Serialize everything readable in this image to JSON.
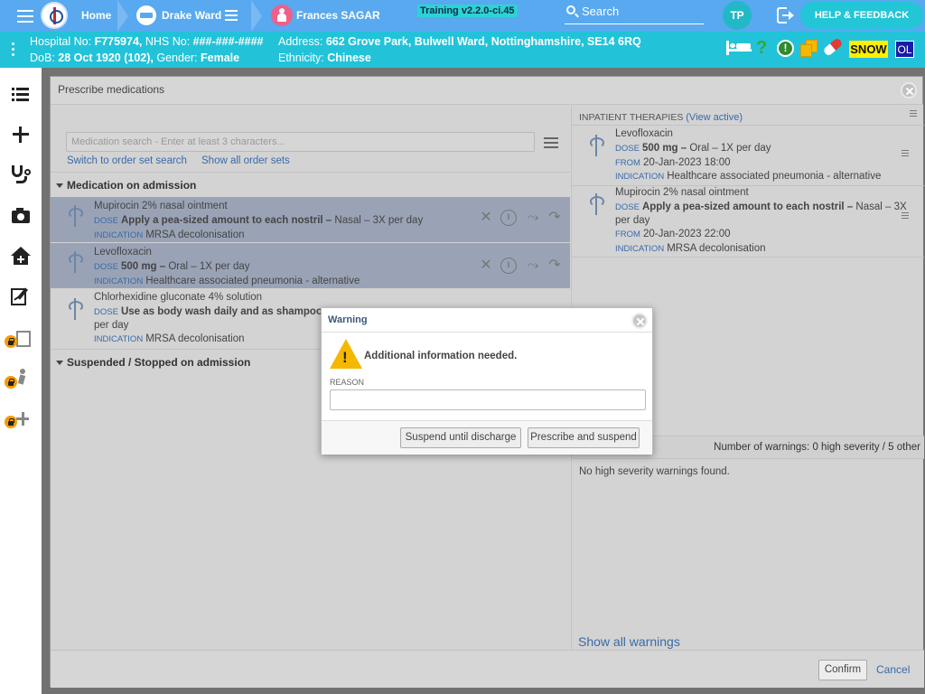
{
  "topbar": {
    "home_label": "Home",
    "ward_label": "Drake Ward",
    "patient_name": "Frances SAGAR",
    "version": "Training v2.2.0-ci.45",
    "search_label": "Search",
    "avatar_initials": "TP",
    "help_label": "HELP & FEEDBACK",
    "colors": {
      "bar": "#58a9ef",
      "accent": "#22c6d6"
    }
  },
  "banner": {
    "hospital_no_label": "Hospital No: ",
    "hospital_no": "F775974,",
    "nhs_no_label": " NHS No: ",
    "nhs_no": "###-###-####",
    "address_label": "Address: ",
    "address": "662 Grove Park, Bulwell Ward, Nottinghamshire, SE14 6RQ",
    "dob_label": "DoB: ",
    "dob": "28 Oct 1920 (102),",
    "gender_label": " Gender: ",
    "gender": "Female",
    "ethnicity_label": "Ethnicity: ",
    "ethnicity": "Chinese",
    "flags": {
      "question": "?",
      "alert": "!",
      "snow": "SNOW",
      "ol": "OL"
    }
  },
  "sidebar": {
    "items": [
      "list-icon",
      "plus-icon",
      "stethoscope-icon",
      "camera-icon",
      "home-plus-icon",
      "edit-chart-icon",
      "clipboard-locked-icon",
      "person-locked-icon",
      "add-locked-icon"
    ]
  },
  "modal": {
    "title": "Prescribe medications",
    "search_placeholder": "Medication search - Enter at least 3 characters...",
    "switch_link": "Switch to order set search",
    "show_all_link": "Show all order sets",
    "section_admission": "Medication on admission",
    "section_suspended": "Suspended / Stopped on admission",
    "meds": [
      {
        "name": "Mupirocin 2% nasal ointment",
        "dose_label": "DOSE",
        "dose": "Apply a pea-sized amount to each nostril –",
        "route": " Nasal – 3X per day",
        "dose2": "",
        "indication_label": "INDICATION",
        "indication": "MRSA decolonisation"
      },
      {
        "name": "Levofloxacin",
        "dose_label": "DOSE",
        "dose": "500 mg –",
        "route": " Oral – 1X per day",
        "dose2": "",
        "indication_label": "INDICATION",
        "indication": "Healthcare associated pneumonia - alternative"
      },
      {
        "name": "Chlorhexidine gluconate 4% solution",
        "dose_label": "DOSE",
        "dose": "Use as body wash daily and as shampoo on",
        "route": "",
        "dose2": "per day",
        "indication_label": "INDICATION",
        "indication": "MRSA decolonisation"
      }
    ],
    "right": {
      "heading": "INPATIENT THERAPIES",
      "view_active": "(View active)",
      "therapies": [
        {
          "name": "Levofloxacin",
          "dose_label": "DOSE",
          "dose": "500 mg –",
          "route": " Oral – 1X per day",
          "route2": "",
          "from_label": "FROM",
          "from": "20-Jan-2023 18:00",
          "indication_label": "INDICATION",
          "indication": "Healthcare associated pneumonia - alternative"
        },
        {
          "name": "Mupirocin 2% nasal ointment",
          "dose_label": "DOSE",
          "dose": "Apply a pea-sized amount to each nostril –",
          "route": " Nasal – 3X",
          "route2": "per day",
          "from_label": "FROM",
          "from": "20-Jan-2023 22:00",
          "indication_label": "INDICATION",
          "indication": "MRSA decolonisation"
        }
      ],
      "warnings_count": "Number of warnings: 0 high severity / 5 other",
      "no_warnings": "No high severity warnings found.",
      "show_all_warnings": "Show all warnings"
    },
    "confirm_label": "Confirm",
    "cancel_label": "Cancel"
  },
  "warning": {
    "title": "Warning",
    "message": "Additional information needed.",
    "reason_label": "REASON",
    "reason_value": "",
    "suspend_btn": "Suspend until discharge",
    "prescribe_btn": "Prescribe and suspend"
  }
}
